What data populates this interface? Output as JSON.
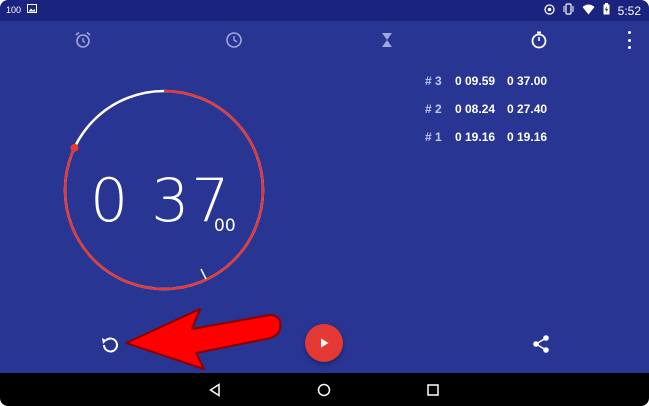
{
  "status_bar": {
    "battery_text": "100",
    "time": "5:52",
    "icons": [
      "battery-icon",
      "image-icon",
      "alarm-status-icon",
      "vibrate-icon",
      "wifi-icon",
      "battery-charging-icon"
    ]
  },
  "tabs": {
    "items": [
      "alarm-icon",
      "clock-icon",
      "timer-icon",
      "stopwatch-icon"
    ],
    "active": "stopwatch-icon",
    "overflow_icon": "more-vert-icon"
  },
  "stopwatch": {
    "elapsed_main": "0 37",
    "elapsed_hundredths": "00",
    "progress_fraction": 0.82
  },
  "laps": [
    {
      "number": "# 3",
      "lap_time": "0 09.59",
      "total_time": "0 37.00"
    },
    {
      "number": "# 2",
      "lap_time": "0 08.24",
      "total_time": "0 27.40"
    },
    {
      "number": "# 1",
      "lap_time": "0 19.16",
      "total_time": "0 19.16"
    }
  ],
  "controls": {
    "reset_icon": "reset-icon",
    "play_icon": "play-icon",
    "share_icon": "share-icon"
  },
  "colors": {
    "background": "#283593",
    "status_bar": "#1a237e",
    "accent": "#e53935",
    "annotation_arrow": "#ff0000"
  },
  "nav_bar": {
    "icons": [
      "back-icon",
      "home-icon",
      "recents-icon"
    ]
  }
}
